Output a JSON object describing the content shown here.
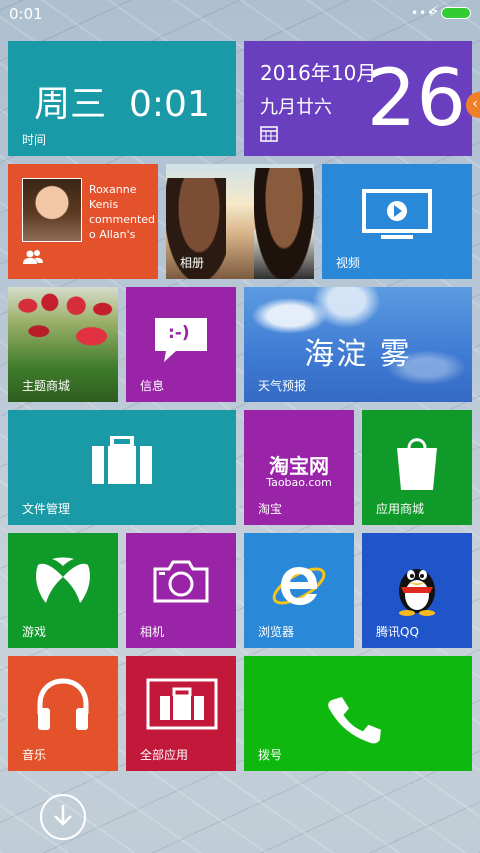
{
  "status_bar": {
    "time": "0:01",
    "dots": "•••",
    "bolt": "⚡"
  },
  "tiles": {
    "clock": {
      "text": "周三  0:01",
      "label": "时间",
      "color": "#1a9aa7"
    },
    "calendar": {
      "date": "2016年10月",
      "lunar": "九月廿六",
      "day": "26",
      "color": "#6a3fbf"
    },
    "people": {
      "notification": "Roxanne Kenis commented o Allan's post.",
      "color": "#e3522a"
    },
    "photos": {
      "label": "相册"
    },
    "video": {
      "label": "视频",
      "color": "#2a88d8"
    },
    "theme_store": {
      "label": "主题商城"
    },
    "messages": {
      "label": "信息",
      "glyph": ":-)",
      "color": "#9a24a8"
    },
    "weather": {
      "text": "海淀 雾",
      "label": "天气预报",
      "color": "#3d7fd6"
    },
    "file_manager": {
      "label": "文件管理",
      "color": "#1a9aa7"
    },
    "taobao": {
      "logo": "淘宝网",
      "domain": "Taobao.com",
      "label": "淘宝",
      "color": "#9a24a8"
    },
    "app_store": {
      "label": "应用商城",
      "color": "#0f9a2a"
    },
    "games": {
      "label": "游戏",
      "color": "#0f9a2a"
    },
    "camera": {
      "label": "相机",
      "color": "#9a24a8"
    },
    "browser": {
      "label": "浏览器",
      "color": "#2a88d8"
    },
    "qq": {
      "label": "腾讯QQ",
      "color": "#1f55c8"
    },
    "music": {
      "label": "音乐",
      "color": "#e3522a"
    },
    "all_apps": {
      "label": "全部应用",
      "color": "#c2183a"
    },
    "dialer": {
      "label": "拨号",
      "color": "#0fb80f"
    }
  },
  "side_tab": {
    "glyph": "‹"
  }
}
